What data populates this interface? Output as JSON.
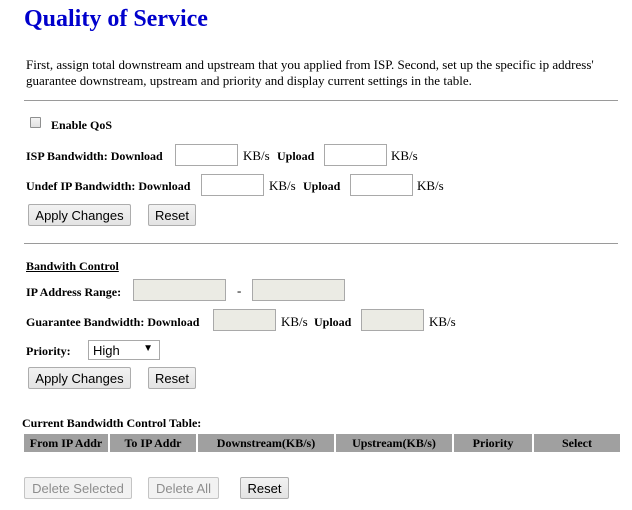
{
  "page": {
    "title": "Quality of Service",
    "description": "First, assign total downstream and upstream that you applied from ISP. Second, set up the specific ip address' guarantee downstream, upstream and priority and display current settings in the table."
  },
  "qos": {
    "enable_label": "Enable QoS",
    "enable_checked": false,
    "isp_label": "ISP Bandwidth: Download",
    "undef_label": "Undef IP Bandwidth: Download",
    "upload_label": "Upload",
    "unit": "KB/s",
    "isp_download": "",
    "isp_upload": "",
    "undef_download": "",
    "undef_upload": "",
    "apply_label": "Apply Changes",
    "reset_label": "Reset"
  },
  "control": {
    "heading": "Bandwith Control",
    "ip_range_label": "IP Address Range:",
    "range_sep": "-",
    "ip_from": "",
    "ip_to": "",
    "guarantee_label": "Guarantee Bandwidth: Download",
    "upload_label": "Upload",
    "unit": "KB/s",
    "guarantee_download": "",
    "guarantee_upload": "",
    "priority_label": "Priority:",
    "priority_value": "High",
    "apply_label": "Apply Changes",
    "reset_label": "Reset"
  },
  "table": {
    "title": "Current Bandwidth Control Table:",
    "columns": [
      "From IP Addr",
      "To IP Addr",
      "Downstream(KB/s)",
      "Upstream(KB/s)",
      "Priority",
      "Select"
    ],
    "rows": [],
    "delete_selected_label": "Delete Selected",
    "delete_all_label": "Delete All",
    "reset_label": "Reset"
  }
}
